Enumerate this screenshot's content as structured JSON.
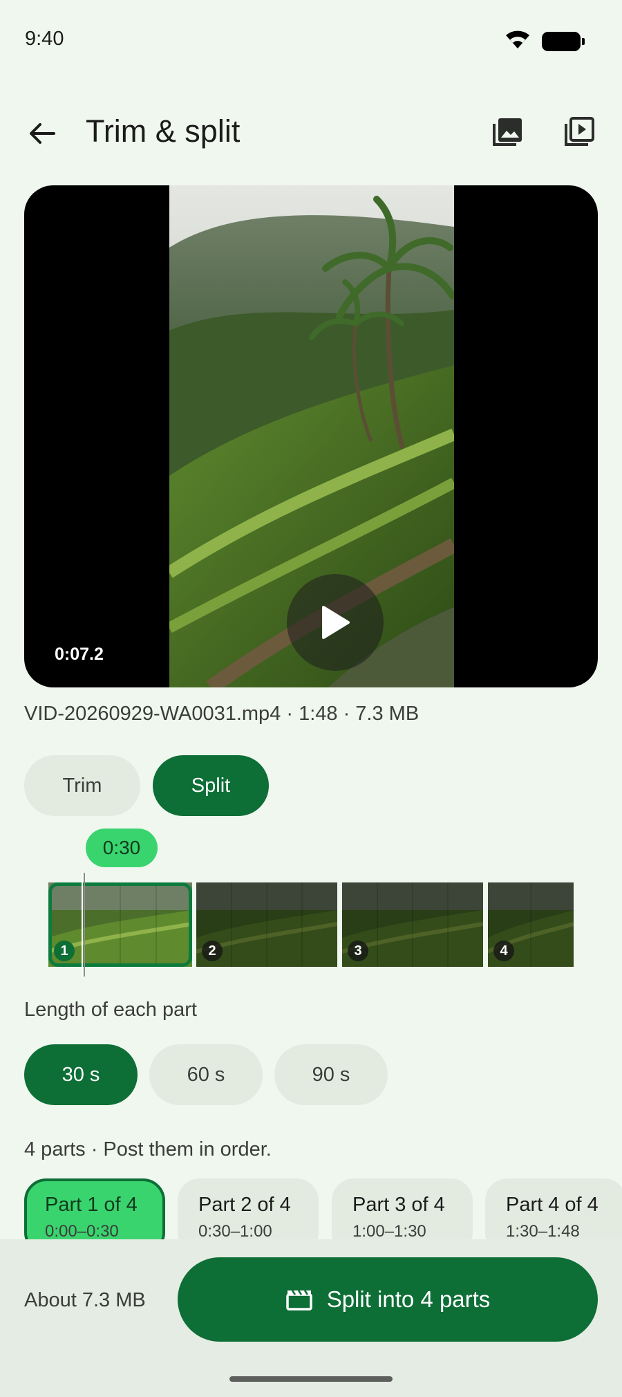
{
  "status_bar": {
    "time": "9:40"
  },
  "app_bar": {
    "title": "Trim & split",
    "icons": [
      "back-arrow-icon",
      "gallery-icon",
      "video-library-icon"
    ]
  },
  "preview": {
    "timecode": "0:07.2",
    "play_icon": "play-icon"
  },
  "file_info": "VID-20260929-WA0031.mp4  ·  1:48 · 7.3 MB",
  "mode_tabs": {
    "trim_label": "Trim",
    "split_label": "Split",
    "selected": "Split"
  },
  "filmstrip": {
    "current_time": "0:30",
    "parts": [
      "1",
      "2",
      "3",
      "4"
    ],
    "active_part": "1"
  },
  "length": {
    "label": "Length of each part",
    "options": [
      "30 s",
      "60 s",
      "90 s"
    ],
    "selected": "30 s"
  },
  "parts_hint": "4 parts · Post them in order.",
  "part_cards": [
    {
      "title": "Part 1 of 4",
      "range": "0:00–0:30"
    },
    {
      "title": "Part 2 of 4",
      "range": "0:30–1:00"
    },
    {
      "title": "Part 3 of 4",
      "range": "1:00–1:30"
    },
    {
      "title": "Part 4 of 4",
      "range": "1:30–1:48"
    }
  ],
  "bottom": {
    "estimate": "About 7.3 MB",
    "primary_label": "Split into 4 parts",
    "primary_icon": "clapperboard-icon"
  },
  "colors": {
    "accent": "#0d6e36",
    "accent_light": "#3ad46f",
    "background": "#f0f7ef",
    "chip_bg": "#e3ebe1"
  }
}
